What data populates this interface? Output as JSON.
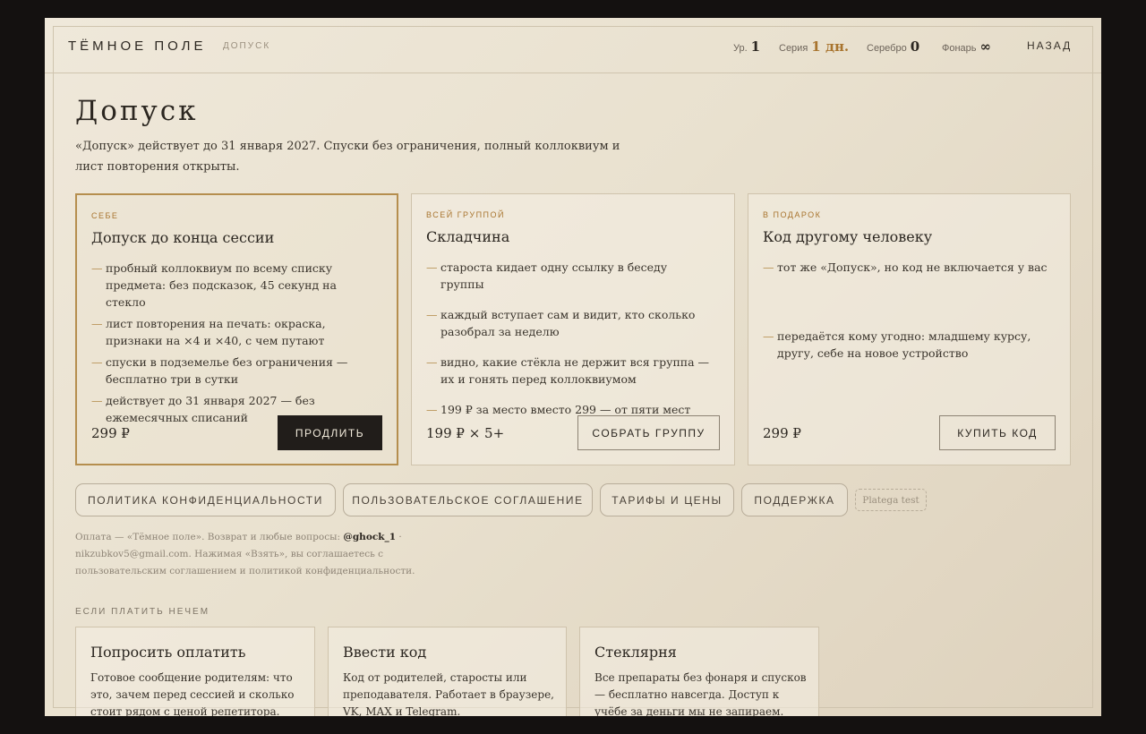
{
  "header": {
    "brand": "ТЁМНОЕ ПОЛЕ",
    "crumb": "ДОПУСК",
    "stats": [
      {
        "label": "Ур.",
        "value": "1"
      },
      {
        "label": "Серия",
        "value": "1 дн."
      },
      {
        "label": "Серебро",
        "value": "0"
      },
      {
        "label": "Фонарь",
        "value": "∞"
      }
    ],
    "back": "НАЗАД"
  },
  "page": {
    "title": "Допуск",
    "lead": "«Допуск» действует до 31 января 2027. Спуски без ограничения, полный коллоквиум и лист повторения открыты."
  },
  "plans": [
    {
      "kicker": "СЕБЕ",
      "title": "Допуск до конца сессии",
      "items": [
        "пробный коллоквиум по всему списку предмета: без подсказок, 45 секунд на стекло",
        "лист повторения на печать: окраска, признаки на ×4 и ×40, с чем путают",
        "спуски в подземелье без ограничения — бесплатно три в сутки",
        "действует до 31 января 2027 — без ежемесячных списаний"
      ],
      "price": "299 ₽",
      "button": "ПРОДЛИТЬ"
    },
    {
      "kicker": "ВСЕЙ ГРУППОЙ",
      "title": "Складчина",
      "items": [
        "староста кидает одну ссылку в беседу группы",
        "каждый вступает сам и видит, кто сколько разобрал за неделю",
        "видно, какие стёкла не держит вся группа — их и гонять перед коллоквиумом",
        "199 ₽ за место вместо 299 — от пяти мест"
      ],
      "price": "199 ₽ × 5+",
      "button": "СОБРАТЬ ГРУППУ"
    },
    {
      "kicker": "В ПОДАРОК",
      "title": "Код другому человеку",
      "items": [
        "тот же «Допуск», но код не включается у вас",
        "передаётся кому угодно: младшему курсу, другу, себе на новое устройство"
      ],
      "price": "299 ₽",
      "button": "КУПИТЬ КОД"
    }
  ],
  "links": [
    "ПОЛИТИКА КОНФИДЕНЦИАЛЬНОСТИ",
    "ПОЛЬЗОВАТЕЛЬСКОЕ СОГЛАШЕНИЕ",
    "ТАРИФЫ И ЦЕНЫ",
    "ПОДДЕРЖКА"
  ],
  "test_tag": "Platega test",
  "footer": {
    "before": "Оплата — «Тёмное поле». Возврат и любые вопросы: ",
    "handle": "@ghock_1",
    "after": " · nikzubkov5@gmail.com. Нажимая «Взять», вы соглашаетесь с пользовательским соглашением и политикой конфиденциальности."
  },
  "alt_section": {
    "title": "ЕСЛИ ПЛАТИТЬ НЕЧЕМ",
    "cards": [
      {
        "title": "Попросить оплатить",
        "text": "Готовое сообщение родителям: что это, зачем перед сессией и сколько стоит рядом с ценой репетитора. Оплатить"
      },
      {
        "title": "Ввести код",
        "text": "Код от родителей, старосты или преподавателя. Работает в браузере, VK, MAX и Telegram."
      },
      {
        "title": "Стеклярня",
        "text": "Все препараты без фонаря и спусков — бесплатно навсегда. Доступ к учёбе за деньги мы не запираем."
      }
    ]
  },
  "colors": {
    "accent": "#a8742e",
    "featured_border": "#b58e4e",
    "dark_button": "#211d1a",
    "backdrop": "#141110"
  }
}
